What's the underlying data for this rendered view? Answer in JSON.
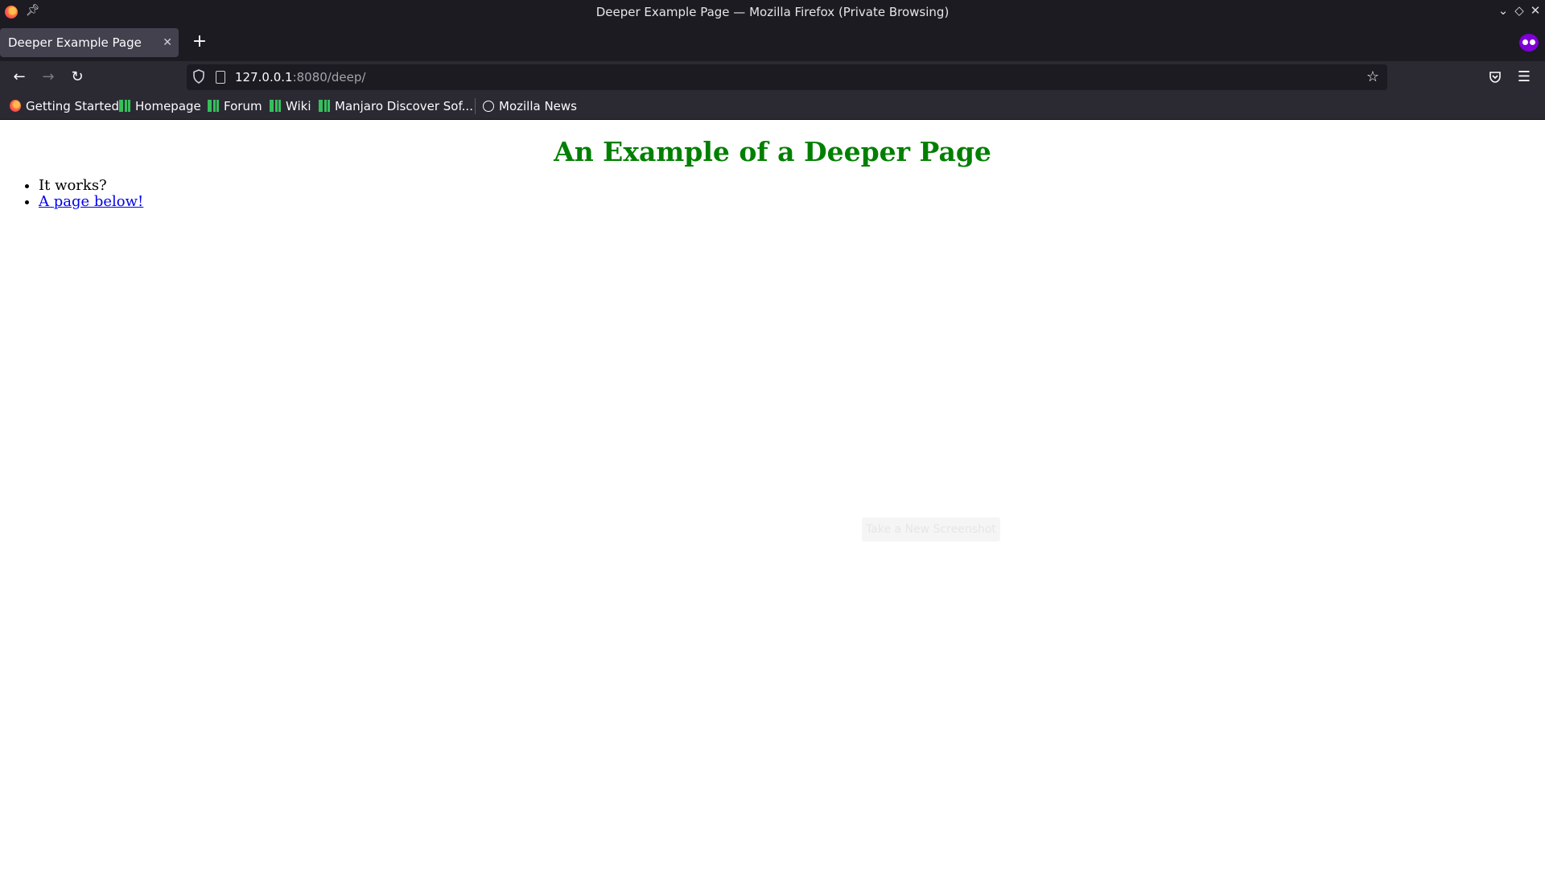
{
  "window": {
    "title": "Deeper Example Page — Mozilla Firefox (Private Browsing)"
  },
  "tabs": [
    {
      "label": "Deeper Example Page",
      "active": true
    }
  ],
  "urlbar": {
    "host": "127.0.0.1",
    "rest": ":8080/deep/"
  },
  "bookmarks": [
    {
      "label": "Getting Started",
      "icon": "firefox-icon"
    },
    {
      "label": "Homepage",
      "icon": "manjaro-icon"
    },
    {
      "label": "Forum",
      "icon": "manjaro-icon"
    },
    {
      "label": "Wiki",
      "icon": "manjaro-icon"
    },
    {
      "label": "Manjaro Discover Sof...",
      "icon": "manjaro-icon"
    },
    {
      "label": "Mozilla News",
      "icon": "globe-icon"
    }
  ],
  "page": {
    "heading": "An Example of a Deeper Page",
    "items": [
      {
        "text": "It works?",
        "link": false
      },
      {
        "text": "A page below!",
        "link": true
      }
    ],
    "overlay_button": "Take a New Screenshot"
  },
  "colors": {
    "heading": "#008000",
    "link": "#0000ee",
    "chrome_dark": "#1c1b22",
    "toolbar": "#2b2a33",
    "private_accent": "#8000d7"
  }
}
